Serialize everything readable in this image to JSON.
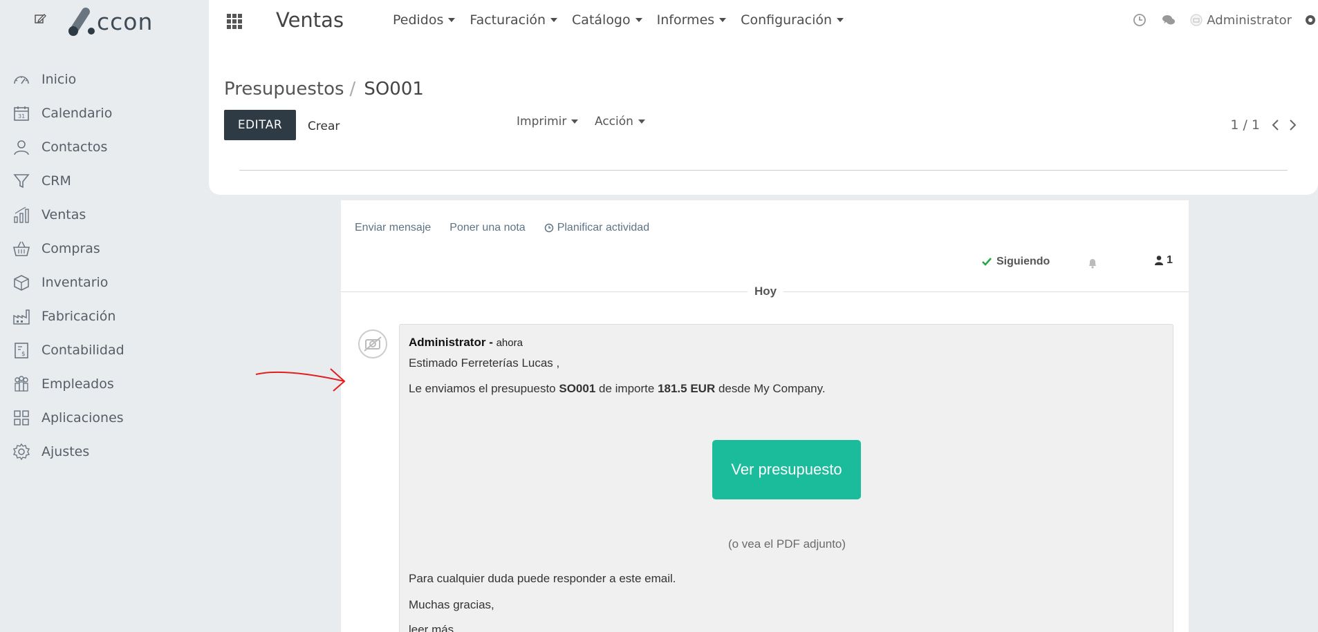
{
  "brand": {
    "logo_text": "ccon"
  },
  "sidebar": {
    "items": [
      {
        "label": "Inicio",
        "icon": "speedometer-icon"
      },
      {
        "label": "Calendario",
        "icon": "calendar-icon"
      },
      {
        "label": "Contactos",
        "icon": "user-icon"
      },
      {
        "label": "CRM",
        "icon": "filter-icon"
      },
      {
        "label": "Ventas",
        "icon": "bar-chart-icon"
      },
      {
        "label": "Compras",
        "icon": "basket-icon"
      },
      {
        "label": "Inventario",
        "icon": "box-icon"
      },
      {
        "label": "Fabricación",
        "icon": "factory-icon"
      },
      {
        "label": "Contabilidad",
        "icon": "invoice-icon"
      },
      {
        "label": "Empleados",
        "icon": "people-icon"
      },
      {
        "label": "Aplicaciones",
        "icon": "grid-icon"
      },
      {
        "label": "Ajustes",
        "icon": "gear-icon"
      }
    ]
  },
  "header": {
    "app_title": "Ventas",
    "menu": [
      "Pedidos",
      "Facturación",
      "Catálogo",
      "Informes",
      "Configuración"
    ],
    "user": "Administrator"
  },
  "control_panel": {
    "breadcrumb_parent": "Presupuestos",
    "breadcrumb_separator": "/",
    "record": "SO001",
    "edit_label": "EDITAR",
    "create_label": "Crear",
    "print_label": "Imprimir",
    "action_label": "Acción",
    "pager": "1 / 1"
  },
  "chatter": {
    "send_message": "Enviar mensaje",
    "log_note": "Poner una nota",
    "schedule_activity": "Planificar actividad",
    "following": "Siguiendo",
    "followers_count": "1",
    "date_separator": "Hoy",
    "message": {
      "author": "Administrator",
      "dash": " - ",
      "date": "ahora",
      "greeting": "Estimado Ferreterías Lucas ,",
      "body_prefix": "Le enviamos el presupuesto ",
      "quote_ref": "SO001",
      "body_mid": " de importe ",
      "amount": "181.5 EUR",
      "body_suffix": " desde My Company.",
      "cta": "Ver presupuesto",
      "pdf_note": "(o vea el PDF adjunto)",
      "reply_note": "Para cualquier duda puede responder a este email.",
      "thanks": "Muchas gracias,",
      "read_more": "leer más"
    }
  },
  "colors": {
    "accent": "#1abc9c",
    "dark_button": "#2e3b45",
    "annotation": "#e11d1d"
  }
}
